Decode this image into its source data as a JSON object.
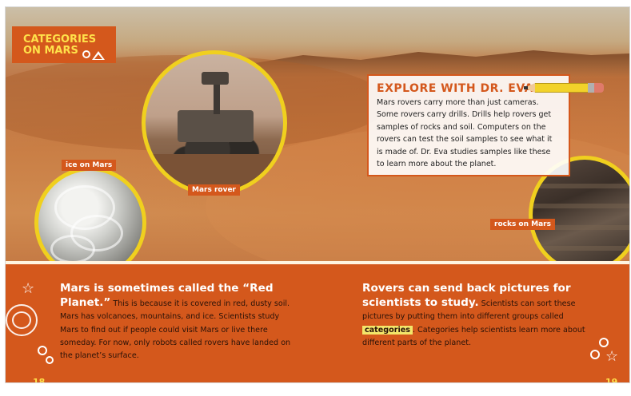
{
  "tag": {
    "line1": "CATEGORIES",
    "line2": "ON MARS"
  },
  "photo_labels": {
    "ice": "ice on Mars",
    "rover": "Mars rover",
    "rocks": "rocks on Mars"
  },
  "explore": {
    "title": "EXPLORE WITH DR. EVA",
    "lines": [
      "Mars rovers carry more than just cameras.",
      "Some rovers carry drills. Drills help rovers get",
      "samples of rocks and soil. Computers on the",
      "rovers can test the soil samples to see what it",
      "is made of. Dr. Eva studies samples like these",
      "to learn more about the planet."
    ]
  },
  "left_col": {
    "lead": "Mars is sometimes called the “Red Planet.”",
    "body": " This is because it is covered in red, dusty soil. Mars has volcanoes, mountains, and ice. Scientists study Mars to find out if people could visit Mars or live there someday. For now, only robots called rovers have landed on the planet’s surface."
  },
  "right_col": {
    "lead": "Rovers can send back pictures for scientists to study.",
    "body_before": " Scientists can sort these pictures by putting them into different groups called ",
    "highlight": "categories",
    "body_after": ". Categories help scientists learn more about different parts of the planet."
  },
  "page_numbers": {
    "left": "18",
    "right": "19"
  },
  "colors": {
    "orange": "#d4581c",
    "yellow": "#f0d01e",
    "highlight": "#f3e66a"
  }
}
